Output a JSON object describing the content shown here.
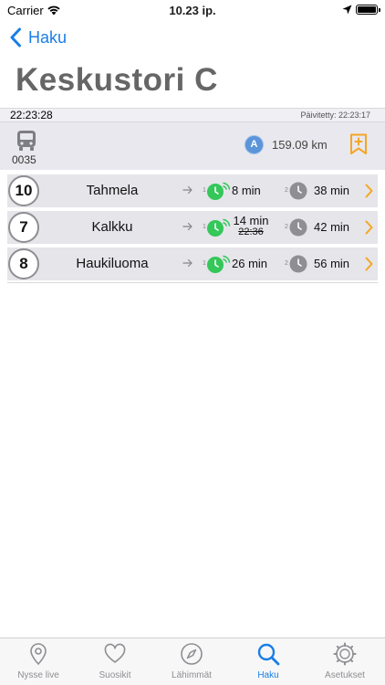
{
  "status_bar": {
    "carrier": "Carrier",
    "time": "10.23 ip."
  },
  "nav": {
    "back_label": "Haku"
  },
  "stop": {
    "name": "Keskustori C",
    "clock": "22:23:28",
    "updated": "Päivitetty: 22:23:17",
    "code": "0035",
    "zone": "A",
    "distance": "159.09 km"
  },
  "departures": [
    {
      "line": "10",
      "destination": "Tahmela",
      "index1": "1",
      "next": "8 min",
      "next_scheduled": "",
      "index2": "2",
      "second": "38 min"
    },
    {
      "line": "7",
      "destination": "Kalkku",
      "index1": "1",
      "next": "14 min",
      "next_scheduled": "22:36",
      "index2": "2",
      "second": "42 min"
    },
    {
      "line": "8",
      "destination": "Haukiluoma",
      "index1": "1",
      "next": "26 min",
      "next_scheduled": "",
      "index2": "2",
      "second": "56 min"
    }
  ],
  "tabs": [
    {
      "label": "Nysse live",
      "icon": "location-pin-icon"
    },
    {
      "label": "Suosikit",
      "icon": "heart-icon"
    },
    {
      "label": "Lähimmät",
      "icon": "compass-icon"
    },
    {
      "label": "Haku",
      "icon": "search-icon",
      "active": true
    },
    {
      "label": "Asetukset",
      "icon": "settings-gear-icon"
    }
  ],
  "colors": {
    "accent": "#1a7ee6",
    "realtime_green": "#34c759",
    "schedule_gray": "#8e8e93",
    "favorite_orange": "#f5a623",
    "zone_blue": "#5b94d8"
  }
}
